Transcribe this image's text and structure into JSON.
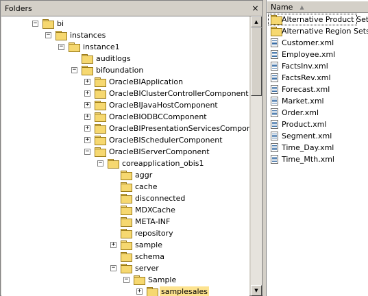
{
  "folders_panel": {
    "title": "Folders",
    "close_glyph": "×"
  },
  "tree": [
    {
      "label": "bi",
      "expander": "−",
      "icon": "folder-icon"
    },
    {
      "label": "instances",
      "expander": "−",
      "icon": "folder-icon"
    },
    {
      "label": "instance1",
      "expander": "−",
      "icon": "folder-icon"
    },
    {
      "label": "auditlogs",
      "expander": "",
      "icon": "folder-icon"
    },
    {
      "label": "bifoundation",
      "expander": "−",
      "icon": "folder-icon"
    },
    {
      "label": "OracleBIApplication",
      "expander": "+",
      "icon": "folder-icon"
    },
    {
      "label": "OracleBIClusterControllerComponent",
      "expander": "+",
      "icon": "folder-icon"
    },
    {
      "label": "OracleBIJavaHostComponent",
      "expander": "+",
      "icon": "folder-icon"
    },
    {
      "label": "OracleBIODBCComponent",
      "expander": "+",
      "icon": "folder-icon"
    },
    {
      "label": "OracleBIPresentationServicesComponent",
      "expander": "+",
      "icon": "folder-icon"
    },
    {
      "label": "OracleBISchedulerComponent",
      "expander": "+",
      "icon": "folder-icon"
    },
    {
      "label": "OracleBIServerComponent",
      "expander": "−",
      "icon": "folder-icon"
    },
    {
      "label": "coreapplication_obis1",
      "expander": "−",
      "icon": "folder-icon"
    },
    {
      "label": "aggr",
      "expander": "",
      "icon": "folder-icon"
    },
    {
      "label": "cache",
      "expander": "",
      "icon": "folder-icon"
    },
    {
      "label": "disconnected",
      "expander": "",
      "icon": "folder-icon"
    },
    {
      "label": "MDXCache",
      "expander": "",
      "icon": "folder-icon"
    },
    {
      "label": "META-INF",
      "expander": "",
      "icon": "folder-icon"
    },
    {
      "label": "repository",
      "expander": "",
      "icon": "folder-icon"
    },
    {
      "label": "sample",
      "expander": "+",
      "icon": "folder-icon"
    },
    {
      "label": "schema",
      "expander": "",
      "icon": "folder-icon"
    },
    {
      "label": "server",
      "expander": "−",
      "icon": "folder-icon"
    },
    {
      "label": "Sample",
      "expander": "−",
      "icon": "folder-icon"
    },
    {
      "label": "samplesales",
      "expander": "+",
      "icon": "folder-icon",
      "selected": true
    }
  ],
  "file_list": {
    "column_name": "Name",
    "sort_glyph": "▲",
    "items": [
      {
        "label": "Alternative Product Sets",
        "icon": "folder-icon"
      },
      {
        "label": "Alternative Region Sets",
        "icon": "folder-icon"
      },
      {
        "label": "Customer.xml",
        "icon": "xml-file-icon"
      },
      {
        "label": "Employee.xml",
        "icon": "xml-file-icon"
      },
      {
        "label": "FactsInv.xml",
        "icon": "xml-file-icon"
      },
      {
        "label": "FactsRev.xml",
        "icon": "xml-file-icon"
      },
      {
        "label": "Forecast.xml",
        "icon": "xml-file-icon"
      },
      {
        "label": "Market.xml",
        "icon": "xml-file-icon"
      },
      {
        "label": "Order.xml",
        "icon": "xml-file-icon"
      },
      {
        "label": "Product.xml",
        "icon": "xml-file-icon"
      },
      {
        "label": "Segment.xml",
        "icon": "xml-file-icon"
      },
      {
        "label": "Time_Day.xml",
        "icon": "xml-file-icon"
      },
      {
        "label": "Time_Mth.xml",
        "icon": "xml-file-icon"
      }
    ]
  }
}
